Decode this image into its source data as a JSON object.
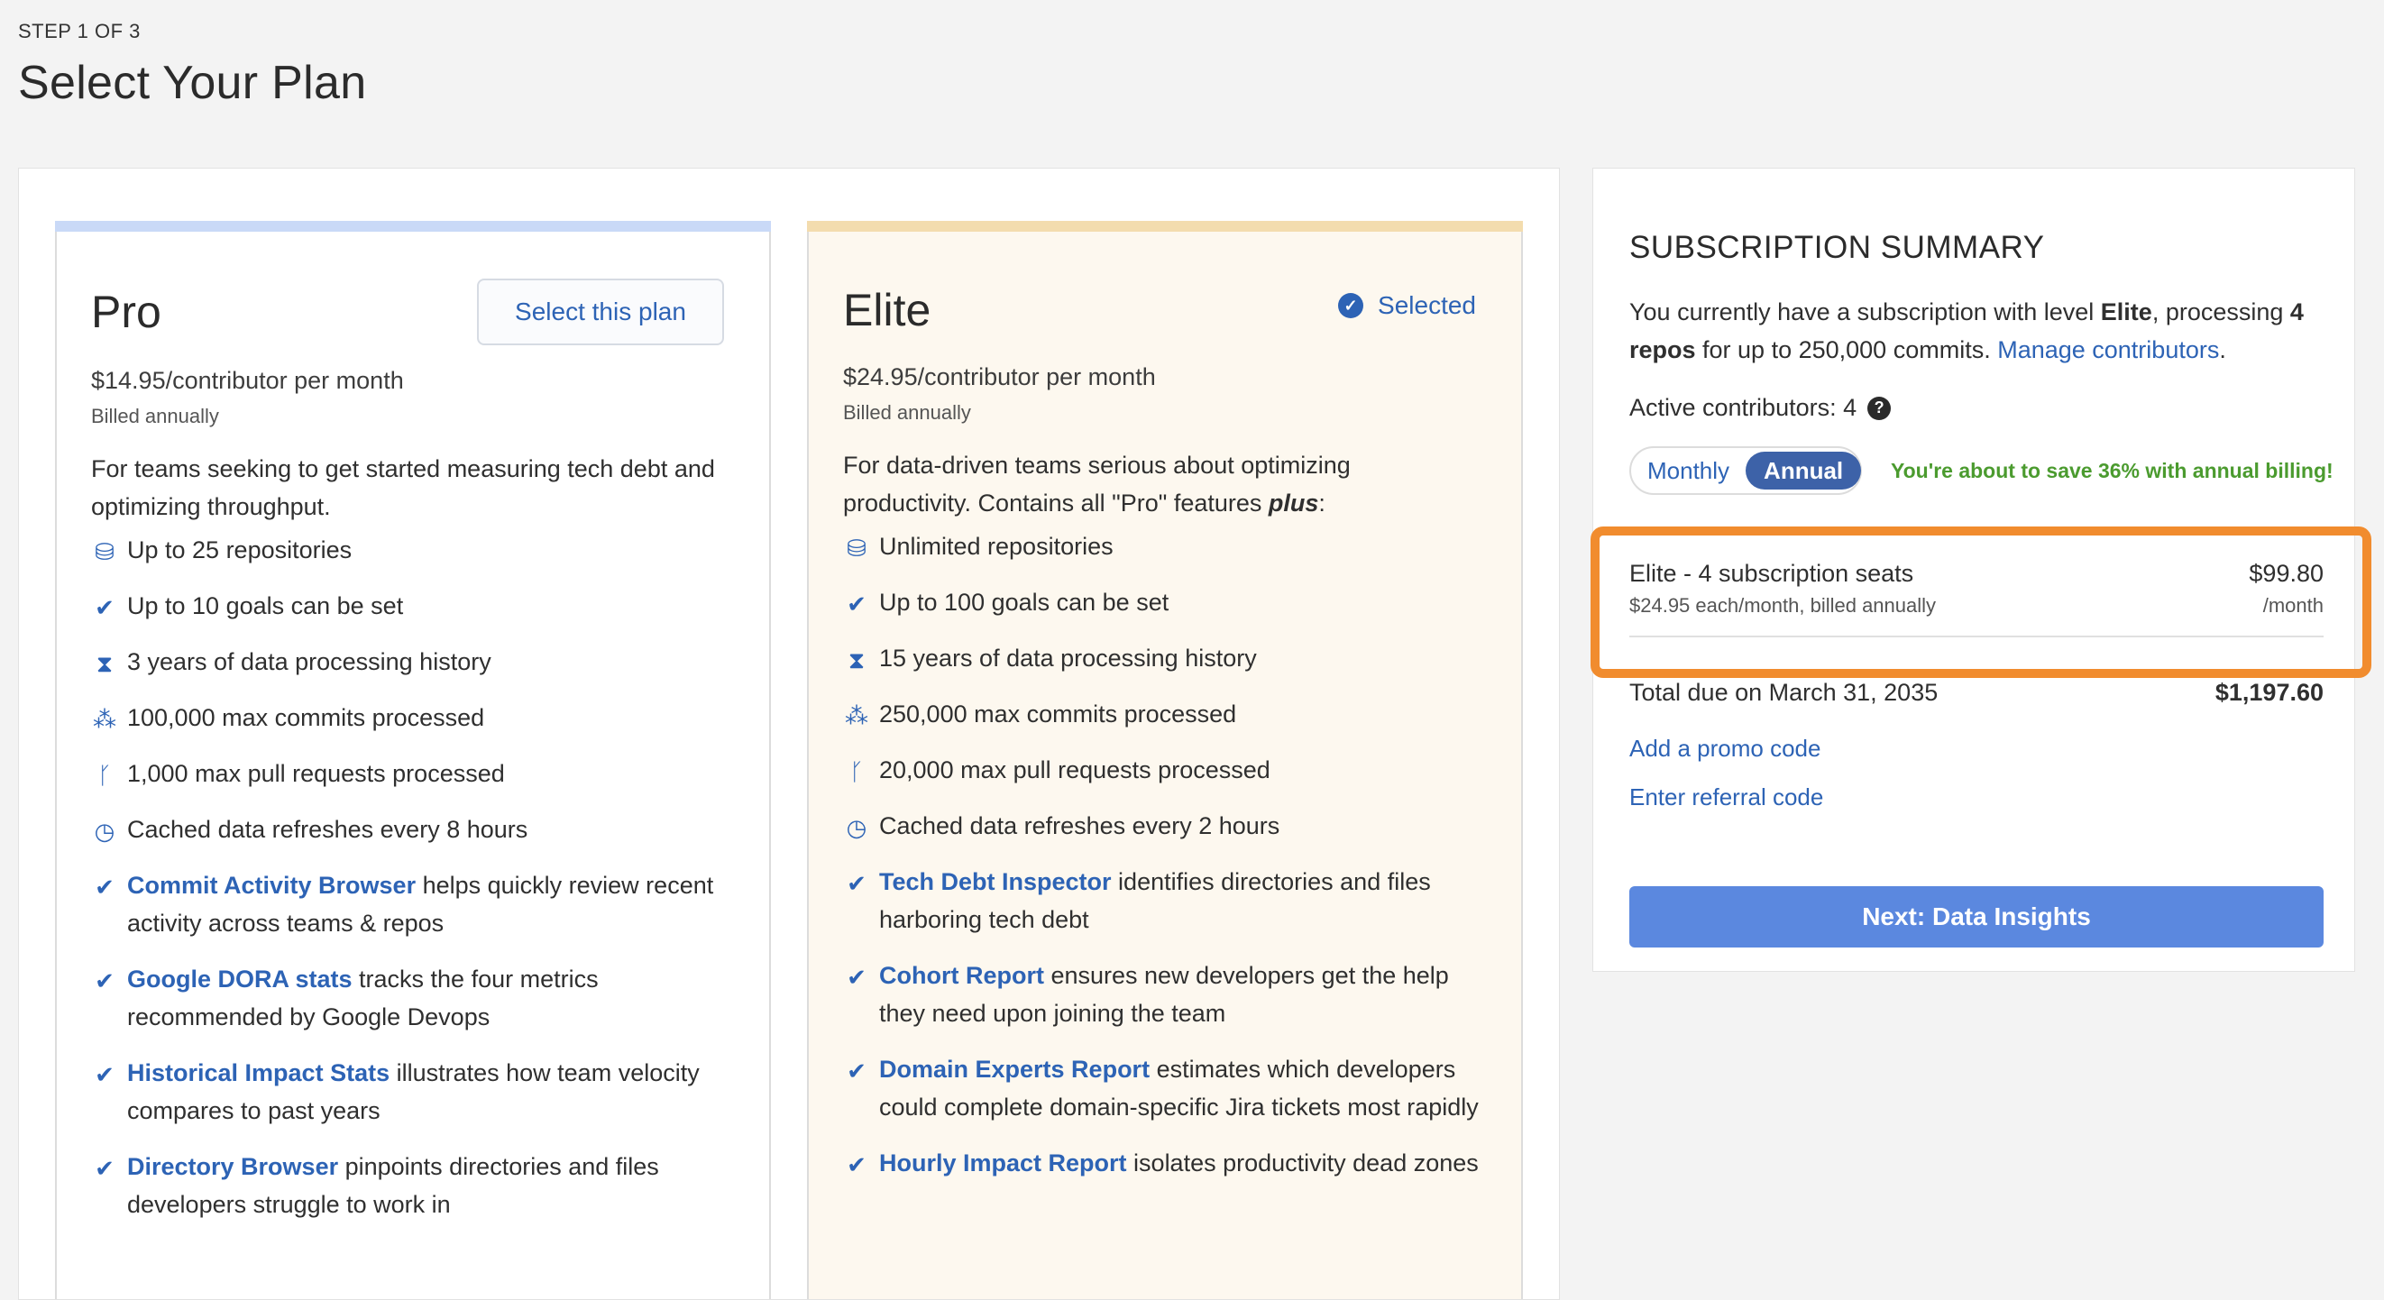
{
  "header": {
    "step": "STEP 1 OF 3",
    "title": "Select Your Plan"
  },
  "colors": {
    "accent": "#2d63b5",
    "pro_bar": "#c9d9f7",
    "elite_bar": "#f3dcae",
    "highlight": "#f18c2e",
    "save_green": "#4b9b2f",
    "next_button": "#5b88df"
  },
  "plans": {
    "pro": {
      "name": "Pro",
      "action_label": "Select this plan",
      "price": "$14.95/contributor per month",
      "billed": "Billed annually",
      "description": "For teams seeking to get started measuring tech debt and optimizing throughput.",
      "features": [
        {
          "icon": "database-icon",
          "text": "Up to 25 repositories"
        },
        {
          "icon": "check-icon",
          "text": "Up to 10 goals can be set"
        },
        {
          "icon": "hourglass-icon",
          "text": "3 years of data processing history"
        },
        {
          "icon": "commits-icon",
          "text": "100,000 max commits processed"
        },
        {
          "icon": "branch-icon",
          "text": "1,000 max pull requests processed"
        },
        {
          "icon": "clock-icon",
          "text": "Cached data refreshes every 8 hours"
        },
        {
          "icon": "check-icon",
          "link": "Commit Activity Browser",
          "text": " helps quickly review recent activity across teams & repos"
        },
        {
          "icon": "check-icon",
          "link": "Google DORA stats",
          "text": " tracks the four metrics recommended by Google Devops"
        },
        {
          "icon": "check-icon",
          "link": "Historical Impact Stats",
          "text": " illustrates how team velocity compares to past years"
        },
        {
          "icon": "check-icon",
          "link": "Directory Browser",
          "text": " pinpoints directories and files developers struggle to work in"
        }
      ]
    },
    "elite": {
      "name": "Elite",
      "status_label": "Selected",
      "price": "$24.95/contributor per month",
      "billed": "Billed annually",
      "description_main": "For data-driven teams serious about optimizing productivity. Contains all \"Pro\" features ",
      "description_em": "plus",
      "description_end": ":",
      "features": [
        {
          "icon": "database-icon",
          "text": "Unlimited repositories"
        },
        {
          "icon": "check-icon",
          "text": "Up to 100 goals can be set"
        },
        {
          "icon": "hourglass-icon",
          "text": "15 years of data processing history"
        },
        {
          "icon": "commits-icon",
          "text": "250,000 max commits processed"
        },
        {
          "icon": "branch-icon",
          "text": "20,000 max pull requests processed"
        },
        {
          "icon": "clock-icon",
          "text": "Cached data refreshes every 2 hours"
        },
        {
          "icon": "check-icon",
          "link": "Tech Debt Inspector",
          "text": " identifies directories and files harboring tech debt"
        },
        {
          "icon": "check-icon",
          "link": "Cohort Report",
          "text": " ensures new developers get the help they need upon joining the team"
        },
        {
          "icon": "check-icon",
          "link": "Domain Experts Report",
          "text": " estimates which developers could complete domain-specific Jira tickets most rapidly"
        },
        {
          "icon": "check-icon",
          "link": "Hourly Impact Report",
          "text": " isolates productivity dead zones"
        }
      ]
    }
  },
  "summary": {
    "title": "SUBSCRIPTION SUMMARY",
    "text_1": "You currently have a subscription with level ",
    "level": "Elite",
    "text_2": ", processing ",
    "repos": "4 repos",
    "text_3": " for up to 250,000 commits. ",
    "manage_link": "Manage contributors",
    "text_4": ".",
    "active_contributors": "Active contributors: 4",
    "toggle": {
      "monthly": "Monthly",
      "annual": "Annual"
    },
    "save_message": "You're about to save 36% with annual billing!",
    "line_item": {
      "name": "Elite - 4 subscription seats",
      "sub": "$24.95 each/month, billed annually",
      "price": "$99.80",
      "unit": "/month"
    },
    "total_label": "Total due on March 31, 2035",
    "total_amount": "$1,197.60",
    "promo_link": "Add a promo code",
    "referral_link": "Enter referral code",
    "next_button": "Next: Data Insights"
  }
}
